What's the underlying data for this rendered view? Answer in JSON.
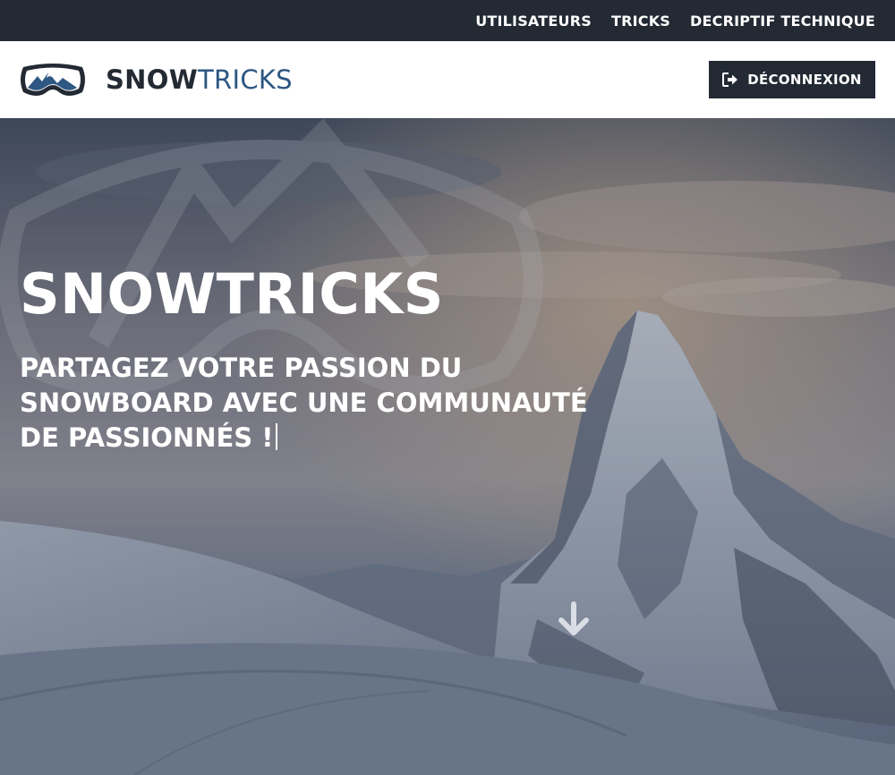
{
  "nav": {
    "links": [
      "UTILISATEURS",
      "TRICKS",
      "DECRIPTIF TECHNIQUE"
    ]
  },
  "header": {
    "brand_bold": "SNOW",
    "brand_light": "TRICKS",
    "logout_label": "DÉCONNEXION",
    "logout_icon": "sign-out-icon"
  },
  "hero": {
    "title": "SNOWTRICKS",
    "subtitle": "PARTAGEZ VOTRE PASSION DU SNOWBOARD AVEC UNE COMMUNAUTÉ DE PASSIONNÉS !",
    "scroll_icon": "arrow-down-icon"
  },
  "colors": {
    "dark": "#232a34",
    "brand_blue": "#2e5782",
    "white": "#ffffff"
  }
}
